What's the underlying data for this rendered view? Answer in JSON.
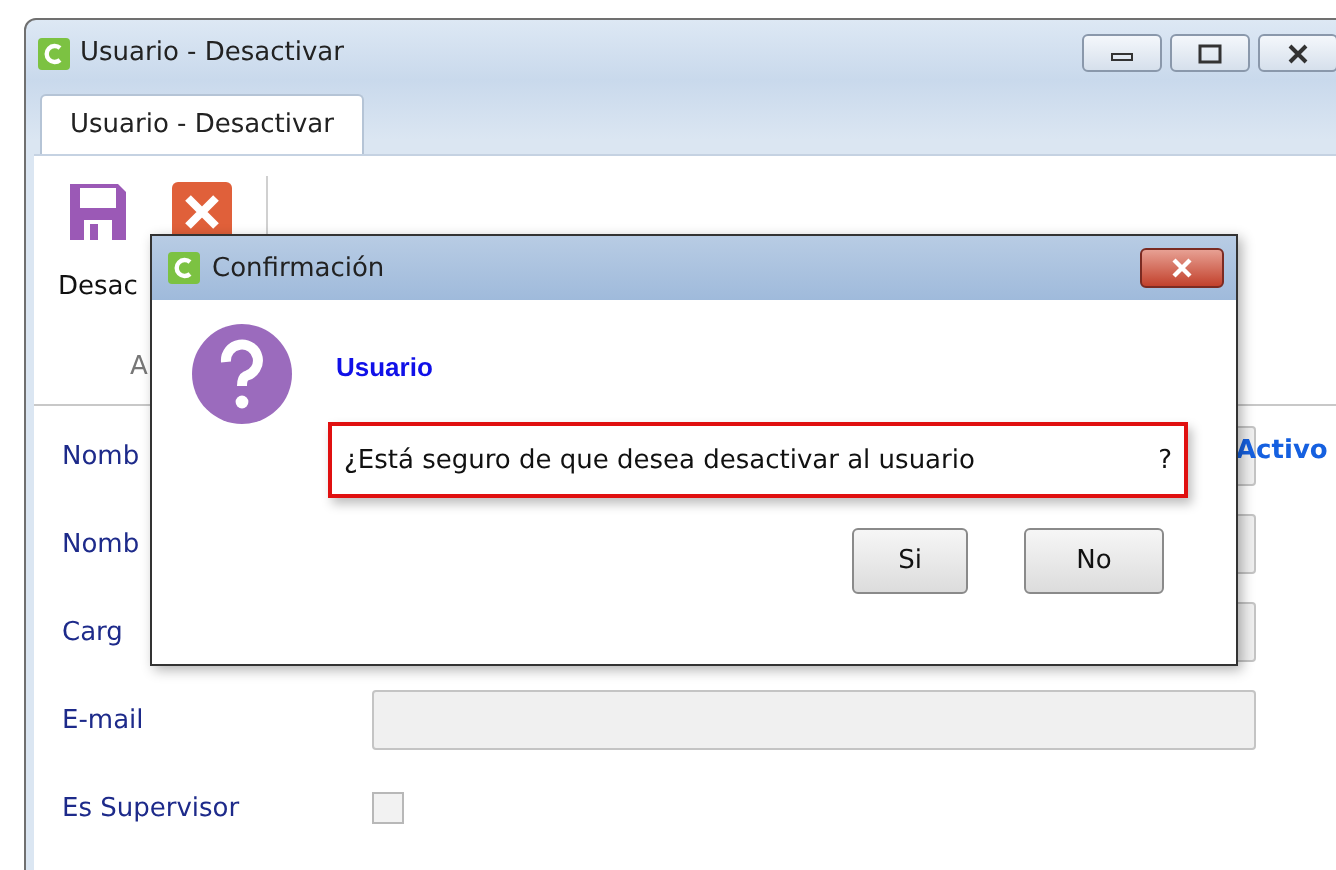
{
  "window": {
    "title": "Usuario - Desactivar"
  },
  "tabs": [
    {
      "label": "Usuario - Desactivar",
      "selected": true
    }
  ],
  "ribbon": {
    "buttons": [
      {
        "kind": "save",
        "label": "Desac"
      },
      {
        "kind": "cancel"
      }
    ],
    "group_label": "A"
  },
  "form": {
    "fields": [
      {
        "kind": "text",
        "label": "Nomb",
        "trailing_label": "Activo"
      },
      {
        "kind": "text",
        "label": "Nomb"
      },
      {
        "kind": "text",
        "label": "Carg"
      },
      {
        "kind": "text",
        "label": "E-mail"
      },
      {
        "kind": "checkbox",
        "label": "Es Supervisor",
        "checked": false
      }
    ]
  },
  "dialog": {
    "title": "Confirmación",
    "heading": "Usuario",
    "message": "¿Está seguro de que desea desactivar al usuario",
    "message_end": "?",
    "buttons": [
      "Si",
      "No"
    ]
  }
}
